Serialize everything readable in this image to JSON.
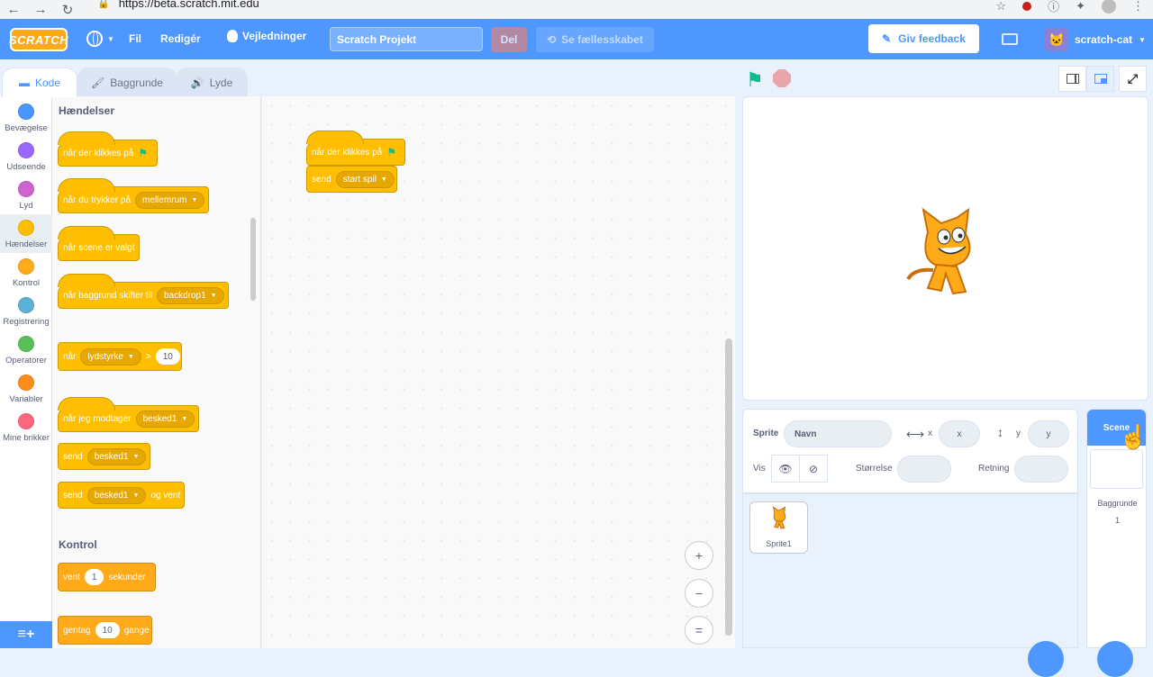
{
  "browser": {
    "url": "https://beta.scratch.mit.edu"
  },
  "menubar": {
    "logo": "SCRATCH",
    "file": "Fil",
    "edit": "Redigér",
    "tutorials": "Vejledninger",
    "project_title": "Scratch Projekt",
    "share": "Del",
    "see_community": "Se fællesskabet",
    "feedback": "Giv feedback",
    "username": "scratch-cat"
  },
  "tabs": {
    "code": "Kode",
    "backdrops": "Baggrunde",
    "sounds": "Lyde"
  },
  "categories": [
    {
      "label": "Bevægelse",
      "color": "#4c97ff"
    },
    {
      "label": "Udseende",
      "color": "#9966ff"
    },
    {
      "label": "Lyd",
      "color": "#cf63cf"
    },
    {
      "label": "Hændelser",
      "color": "#ffbf00"
    },
    {
      "label": "Kontrol",
      "color": "#ffab19"
    },
    {
      "label": "Registrering",
      "color": "#5cb1d6"
    },
    {
      "label": "Operatorer",
      "color": "#59c059"
    },
    {
      "label": "Variabler",
      "color": "#ff8c1a"
    },
    {
      "label": "Mine brikker",
      "color": "#ff6680"
    }
  ],
  "palette": {
    "events_title": "Hændelser",
    "control_title": "Kontrol",
    "blocks": {
      "when_flag": "når der klikkes på",
      "when_key": "når du trykker på",
      "key_value": "mellemrum",
      "when_scene": "når scene er valgt",
      "when_backdrop": "når baggrund skifter til",
      "backdrop_value": "backdrop1",
      "when_prefix": "når",
      "loudness": "lydstyrke",
      "gt": ">",
      "loudness_value": "10",
      "when_receive": "når jeg modtager",
      "message1": "besked1",
      "broadcast": "send",
      "broadcast_wait_suffix": "og vent",
      "wait": "vent",
      "wait_value": "1",
      "seconds": "sekunder",
      "repeat": "gentag",
      "repeat_value": "10",
      "times": "gange"
    }
  },
  "script": {
    "hat": "når der klikkes på",
    "send": "send",
    "message": "start spil"
  },
  "zoom": {
    "in": "+",
    "out": "−",
    "reset": "="
  },
  "sprite_info": {
    "sprite_label": "Sprite",
    "name_placeholder": "Navn",
    "x_label": "x",
    "x_placeholder": "x",
    "y_label": "y",
    "y_placeholder": "y",
    "show_label": "Vis",
    "size_label": "Størrelse",
    "direction_label": "Retning"
  },
  "sprites": [
    {
      "name": "Sprite1"
    }
  ],
  "stage_panel": {
    "header": "Scene",
    "backdrops_label": "Baggrunde",
    "backdrops_count": "1"
  }
}
